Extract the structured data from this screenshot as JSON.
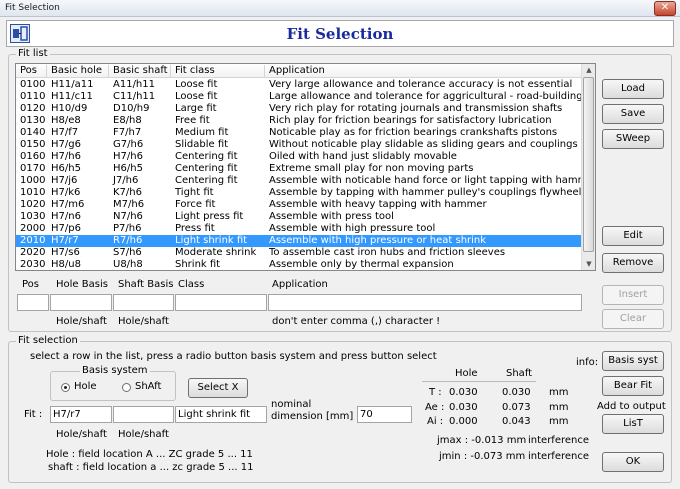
{
  "window": {
    "title": "Fit Selection",
    "close": "✕"
  },
  "header": {
    "title": "Fit Selection"
  },
  "fit_list": {
    "label": "Fit list",
    "columns": [
      "Pos",
      "Basic hole",
      "Basic shaft",
      "Fit class",
      "Application"
    ],
    "rows": [
      [
        "0100",
        "H11/a11",
        "A11/h11",
        "Loose fit",
        "Very large allowance and tolerance accuracy is not essential"
      ],
      [
        "0110",
        "H11/c11",
        "C11/h11",
        "Loose fit",
        "Large allowance and tolerance for aggricultural - road-building"
      ],
      [
        "0120",
        "H10/d9",
        "D10/h9",
        "Large fit",
        "Very rich play for rotating journals and transmission shafts"
      ],
      [
        "0130",
        "H8/e8",
        "E8/h8",
        "Free fit",
        "Rich play for friction bearings for satisfactory lubrication"
      ],
      [
        "0140",
        "H7/f7",
        "F7/h7",
        "Medium fit",
        "Noticable play as for friction bearings crankshafts pistons"
      ],
      [
        "0150",
        "H7/g6",
        "G7/h6",
        "Slidable fit",
        "Without noticable play slidable as sliding gears and couplings"
      ],
      [
        "0160",
        "H7/h6",
        "H7/h6",
        "Centering fit",
        "Oiled with hand just slidably movable"
      ],
      [
        "0170",
        "H6/h5",
        "H6/h5",
        "Centering fit",
        "Extreme small play for non moving parts"
      ],
      [
        "1000",
        "H7/j6",
        "J7/h6",
        "Centering fit",
        "Assemble with noticable hand force or light tapping with hammer"
      ],
      [
        "1010",
        "H7/k6",
        "K7/h6",
        "Tight fit",
        "Assemble by tapping with hammer pulley's couplings flywheel"
      ],
      [
        "1020",
        "H7/m6",
        "M7/h6",
        "Force fit",
        "Assemble with heavy tapping with hammer"
      ],
      [
        "1030",
        "H7/n6",
        "N7/h6",
        "Light press fit",
        "Assemble with press tool"
      ],
      [
        "2000",
        "H7/p6",
        "P7/h6",
        "Press fit",
        "Assemble with high pressure tool"
      ],
      [
        "2010",
        "H7/r7",
        "R7/h6",
        "Light shrink fit",
        "Assemble with high pressure or heat shrink"
      ],
      [
        "2020",
        "H7/s6",
        "S7/h6",
        "Moderate shrink",
        "To assemble cast iron hubs and friction sleeves"
      ],
      [
        "2030",
        "H8/u8",
        "U8/h8",
        "Shrink fit",
        "Assemble only by thermal expansion"
      ]
    ],
    "selected_index": 13,
    "scroll_up": "▲",
    "scroll_down": "▼"
  },
  "buttons": {
    "load": "Load",
    "save": "Save",
    "sweep": "SWeep",
    "edit": "Edit",
    "remove": "Remove",
    "insert": "Insert",
    "clear": "Clear",
    "select_x": "Select X",
    "basis_syst": "Basis syst",
    "bear_fit": "Bear Fit",
    "list": "LisT",
    "ok": "OK"
  },
  "edit_row": {
    "labels": [
      "Pos",
      "Hole Basis",
      "Shaft Basis",
      "Class",
      "Application"
    ],
    "hole_shaft_1": "Hole/shaft",
    "hole_shaft_2": "Hole/shaft",
    "hint": "don't enter comma (,) character !"
  },
  "fit_selection": {
    "label": "Fit selection",
    "instruction": "select a row in the list, press a radio button basis system and press button select",
    "basis_system_label": "Basis system",
    "radio_hole": "Hole",
    "radio_shaft": "ShAft",
    "fit_label": "Fit :",
    "fit_value": "H7/r7",
    "fit_value2": "",
    "fit_class_value": "Light shrink fit",
    "nominal_label1": "nominal",
    "nominal_label2": "dimension  [mm]",
    "nominal_value": "70",
    "hole_shaft_1": "Hole/shaft",
    "hole_shaft_2": "Hole/shaft",
    "hole_help": "Hole :  field location   A ... ZC   grade 5 ... 11",
    "shaft_help": "shaft :  field location  a ... zc    grade 5 ... 11",
    "info_label": "info:",
    "add_to_output": "Add to output",
    "results": {
      "col_hole": "Hole",
      "col_shaft": "Shaft",
      "rows": [
        {
          "label": "T :",
          "hole": "0.030",
          "shaft": "0.030",
          "unit": "mm"
        },
        {
          "label": "Ae :",
          "hole": "0.030",
          "shaft": "0.073",
          "unit": "mm"
        },
        {
          "label": "Ai :",
          "hole": "0.000",
          "shaft": "0.043",
          "unit": "mm"
        }
      ],
      "jmax": "jmax :  -0.013 mm",
      "jmin": "jmin :  -0.073 mm",
      "interference": "interference"
    }
  }
}
